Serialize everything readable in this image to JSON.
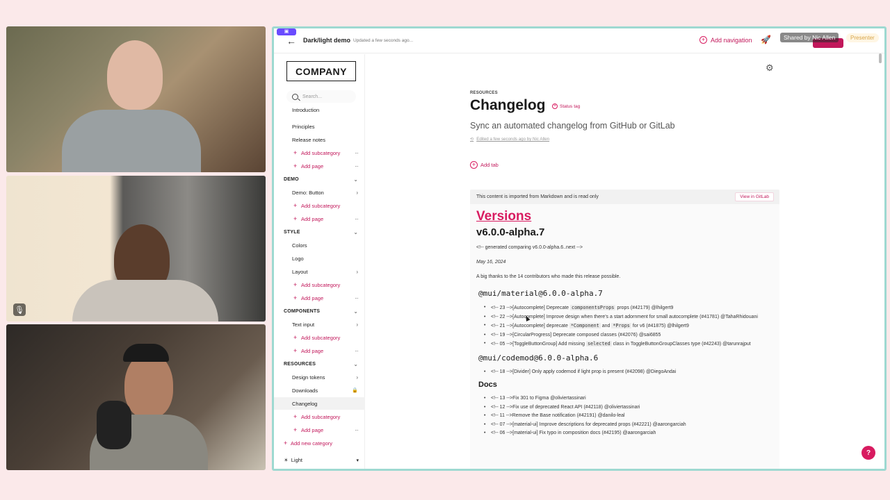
{
  "screen": {
    "share_pill": "▣",
    "doc_title": "Dark/light demo",
    "updated": "Updated a few seconds ago...",
    "add_navigation": "Add navigation",
    "shared_by": "Shared by Nic Allen",
    "presenter": "Presenter"
  },
  "sidebar": {
    "logo": "COMPANY",
    "search_placeholder": "Search...",
    "items": [
      {
        "type": "page",
        "label": "Introduction"
      },
      {
        "type": "page",
        "label": "Principles"
      },
      {
        "type": "page",
        "label": "Release notes"
      },
      {
        "type": "add",
        "label": "Add subcategory",
        "extra": "dots"
      },
      {
        "type": "add",
        "label": "Add page",
        "extra": "dots"
      },
      {
        "type": "cat",
        "label": "DEMO",
        "extra": "chev-down"
      },
      {
        "type": "page",
        "label": "Demo: Button",
        "extra": "chev-right"
      },
      {
        "type": "add",
        "label": "Add subcategory"
      },
      {
        "type": "add",
        "label": "Add page",
        "extra": "dots"
      },
      {
        "type": "cat",
        "label": "STYLE",
        "extra": "chev-down"
      },
      {
        "type": "page",
        "label": "Colors"
      },
      {
        "type": "page",
        "label": "Logo"
      },
      {
        "type": "page",
        "label": "Layout",
        "extra": "chev-right"
      },
      {
        "type": "add",
        "label": "Add subcategory"
      },
      {
        "type": "add",
        "label": "Add page",
        "extra": "dots"
      },
      {
        "type": "cat",
        "label": "COMPONENTS",
        "extra": "chev-down"
      },
      {
        "type": "page",
        "label": "Text input",
        "extra": "chev-right"
      },
      {
        "type": "add",
        "label": "Add subcategory"
      },
      {
        "type": "add",
        "label": "Add page",
        "extra": "dots"
      },
      {
        "type": "cat",
        "label": "RESOURCES",
        "extra": "chev-down"
      },
      {
        "type": "page",
        "label": "Design tokens",
        "extra": "chev-right"
      },
      {
        "type": "page",
        "label": "Downloads",
        "extra": "lock"
      },
      {
        "type": "page",
        "label": "Changelog",
        "active": true
      },
      {
        "type": "add",
        "label": "Add subcategory"
      },
      {
        "type": "add",
        "label": "Add page",
        "extra": "dots"
      },
      {
        "type": "newcat",
        "label": "Add new category"
      }
    ],
    "theme": "Light"
  },
  "main": {
    "overline": "RESOURCES",
    "title": "Changelog",
    "status_tag": "Status tag",
    "subtitle": "Sync an automated changelog from GitHub or GitLab",
    "edited": "Edited a few seconds ago by Nic Allen",
    "add_tab": "Add tab",
    "banner_text": "This content is imported from Markdown and is read only",
    "banner_link": "View in GitLab",
    "md": {
      "h1": "Versions",
      "h2": "v6.0.0-alpha.7",
      "generated": "<!-- generated comparing v6.0.0-alpha.6..next -->",
      "date": "May 16, 2024",
      "thanks": "A big thanks to the 14 contributors who made this release possible.",
      "sec1": "@mui/material@6.0.0-alpha.7",
      "sec2": "@mui/codemod@6.0.0-alpha.6",
      "sec3": "Docs"
    }
  }
}
